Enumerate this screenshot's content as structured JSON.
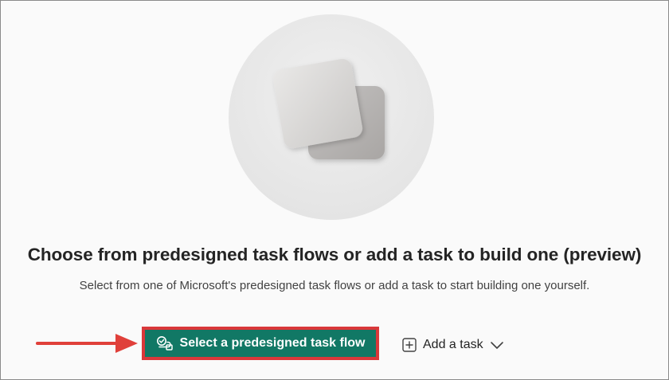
{
  "empty_state": {
    "title": "Choose from predesigned task flows or add a task to build one (preview)",
    "description": "Select from one of Microsoft's predesigned task flows or add a task to start building one yourself."
  },
  "actions": {
    "primary": {
      "label": "Select a predesigned task flow",
      "icon": "task-flow-icon"
    },
    "secondary": {
      "label": "Add a task",
      "icon": "add-square-icon",
      "dropdown_icon": "chevron-down-icon"
    }
  },
  "annotation": {
    "arrow_icon": "arrow-right-icon",
    "highlight_color": "#d9383a"
  },
  "colors": {
    "primary_button": "#117865",
    "callout": "#d9383a"
  }
}
